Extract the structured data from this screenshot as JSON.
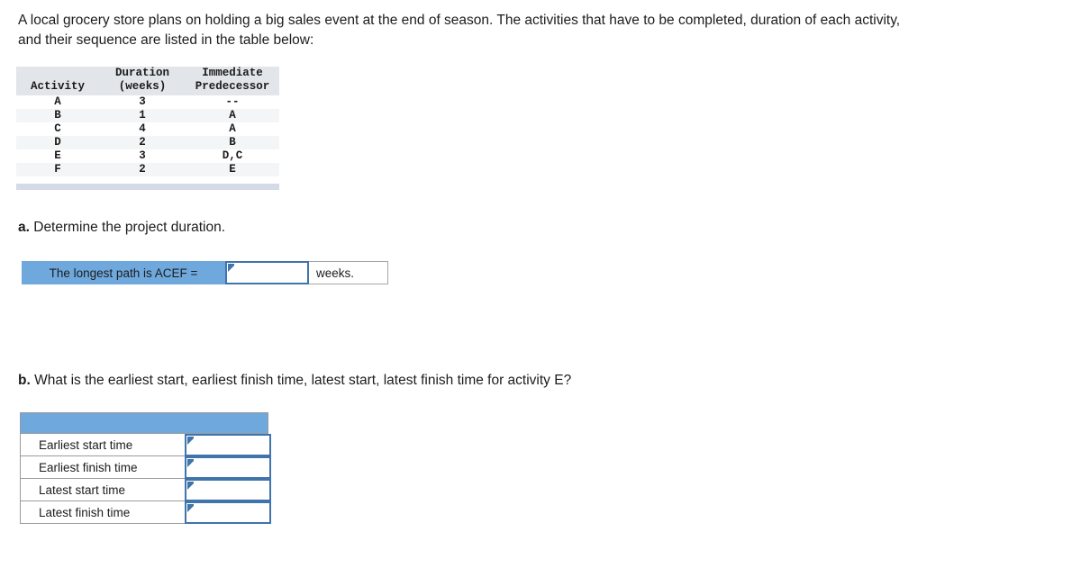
{
  "intro": {
    "text": "A local grocery store plans on holding a big sales event at the end of season. The activities that have to be completed, duration of each activity, and their sequence are listed in the table below:"
  },
  "activity_table": {
    "headers": [
      {
        "top": "",
        "bottom": "Activity"
      },
      {
        "top": "Duration",
        "bottom": "(weeks)"
      },
      {
        "top": "Immediate",
        "bottom": "Predecessor"
      }
    ],
    "rows": [
      {
        "activity": "A",
        "duration": "3",
        "predecessor": "--"
      },
      {
        "activity": "B",
        "duration": "1",
        "predecessor": "A"
      },
      {
        "activity": "C",
        "duration": "4",
        "predecessor": "A"
      },
      {
        "activity": "D",
        "duration": "2",
        "predecessor": "B"
      },
      {
        "activity": "E",
        "duration": "3",
        "predecessor": "D,C"
      },
      {
        "activity": "F",
        "duration": "2",
        "predecessor": "E"
      }
    ]
  },
  "question_a": {
    "label": "a.",
    "text": " Determine the project duration.",
    "answer_row": {
      "prompt": "The longest path is ACEF =",
      "input_value": "",
      "input_placeholder": "",
      "unit": "weeks."
    }
  },
  "question_b": {
    "label": "b.",
    "text": " What is the earliest start, earliest finish time, latest start, latest finish time for activity E?",
    "header_text": "",
    "rows": [
      {
        "label": "Earliest start time",
        "value": ""
      },
      {
        "label": "Earliest finish time",
        "value": ""
      },
      {
        "label": "Latest start time",
        "value": ""
      },
      {
        "label": "Latest finish time",
        "value": ""
      }
    ]
  },
  "colors": {
    "accent_blue": "#6fa8dc",
    "input_border_blue": "#3f74ac",
    "table_header_gray": "#e2e5e9",
    "table_alt_row": "#f4f5f6",
    "table_footer_bar": "#d4dae6",
    "cell_border_gray": "#9b9b9b",
    "text": "#1c1c1c"
  }
}
